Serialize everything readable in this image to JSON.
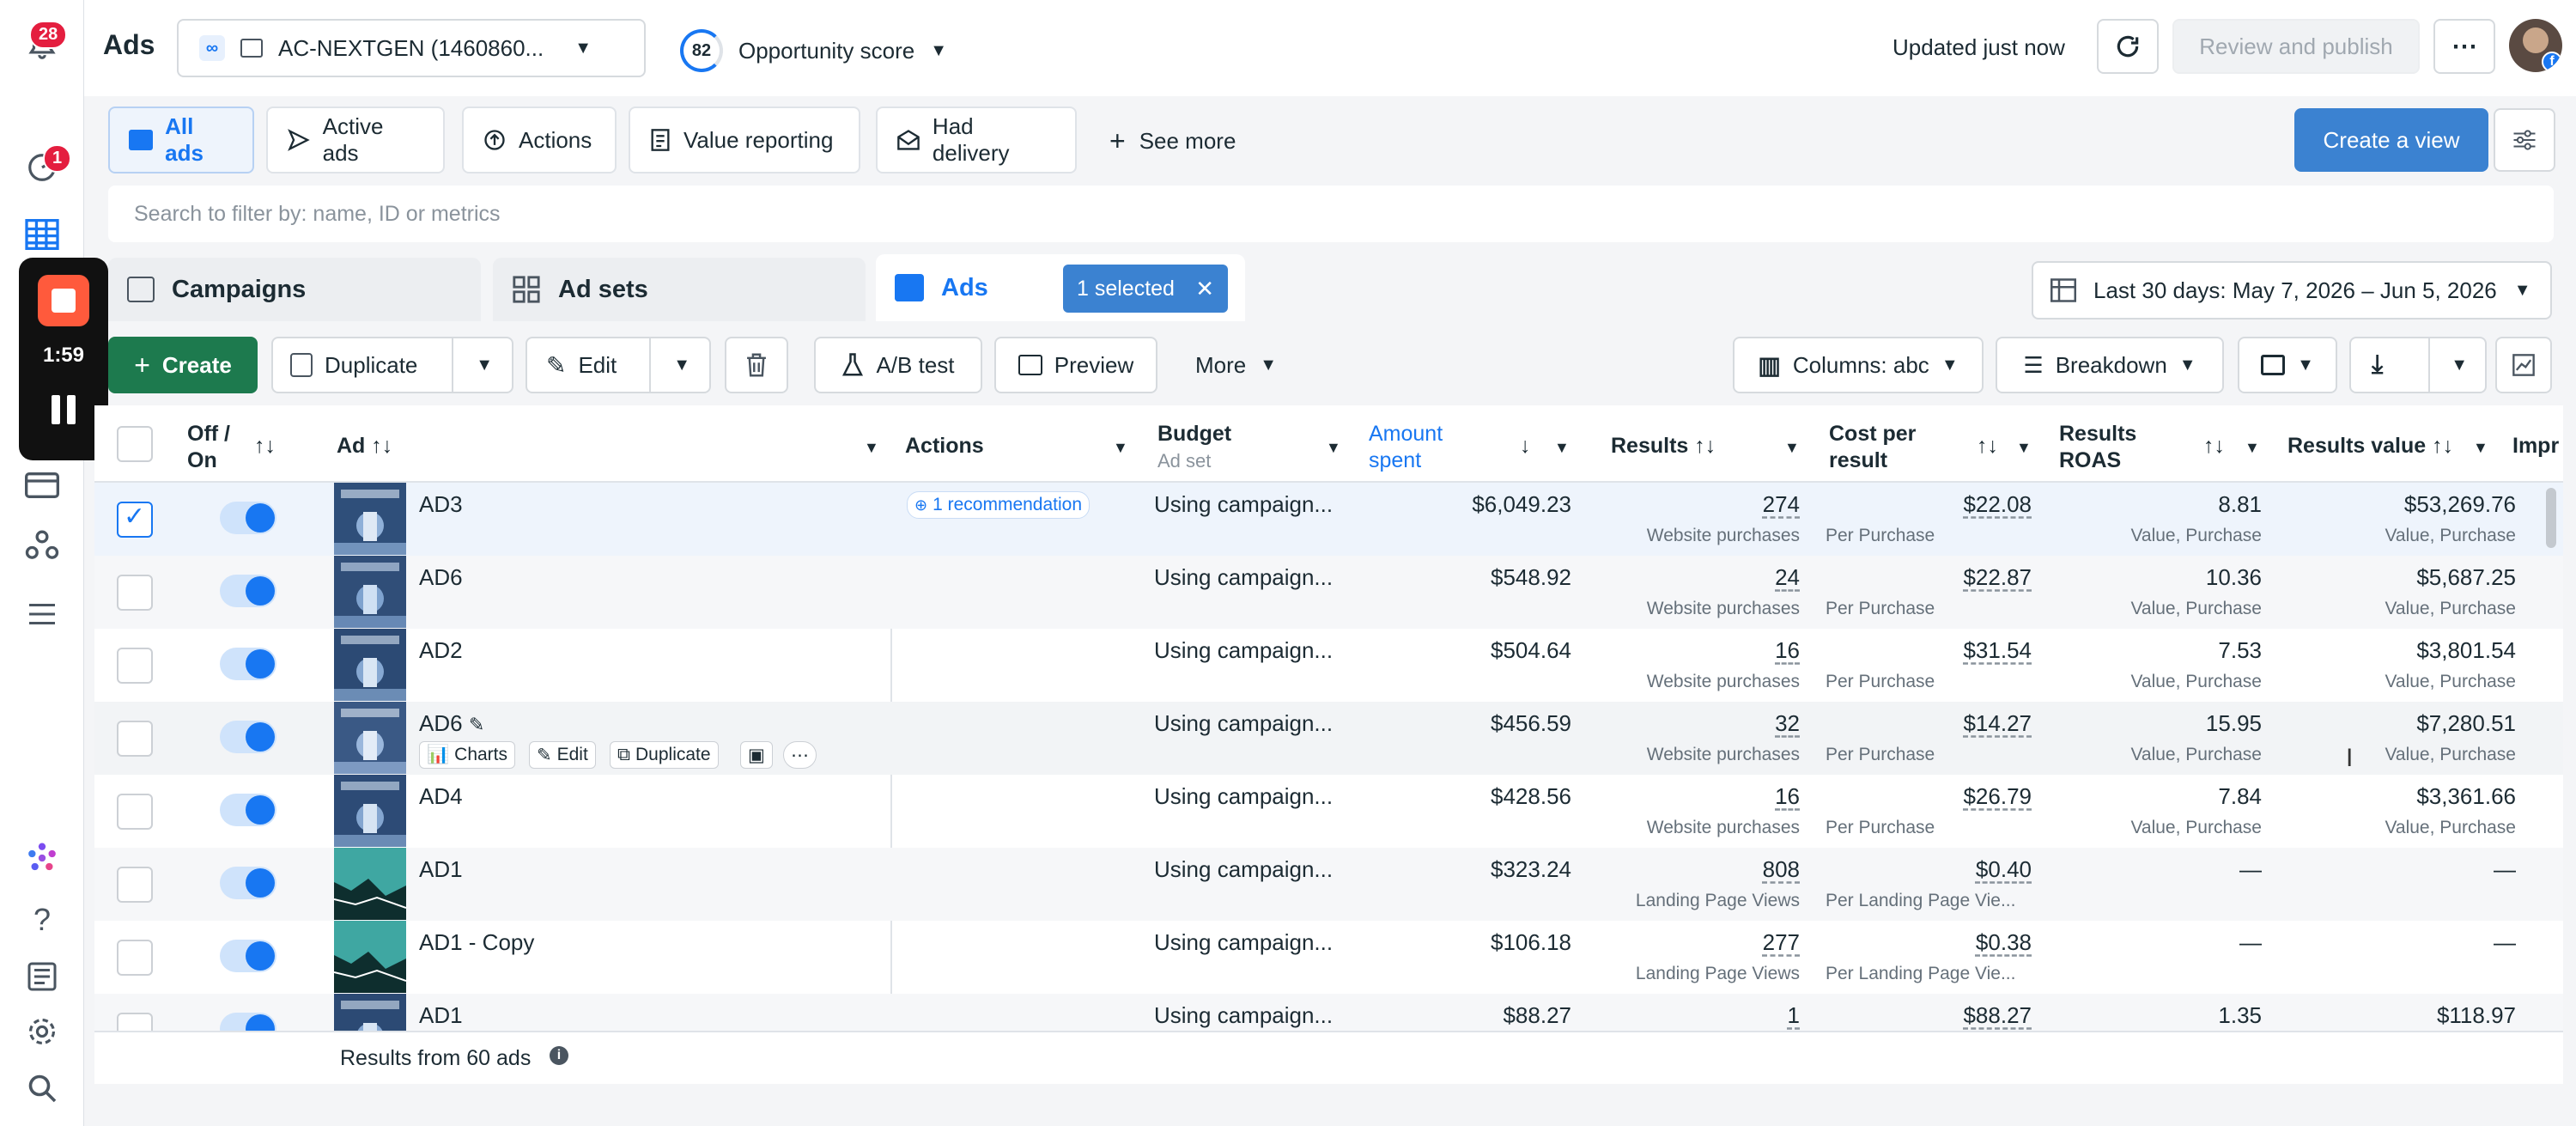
{
  "rail": {
    "notif_count": "28",
    "planner_count": "1",
    "recording_time": "1:59"
  },
  "header": {
    "title": "Ads",
    "account": "AC-NEXTGEN (1460860...",
    "opp_score": "82",
    "opp_label": "Opportunity score",
    "updated": "Updated just now",
    "review": "Review and publish"
  },
  "views": {
    "items": [
      "All ads",
      "Active ads",
      "Actions",
      "Value reporting",
      "Had delivery"
    ],
    "see_more": "See more",
    "create_view": "Create a view"
  },
  "search": {
    "placeholder": "Search to filter by: name, ID or metrics"
  },
  "levels": {
    "campaigns": "Campaigns",
    "adsets": "Ad sets",
    "ads": "Ads",
    "selected": "1 selected",
    "date": "Last 30 days: May 7, 2026 – Jun 5, 2026"
  },
  "toolbar": {
    "create": "Create",
    "duplicate": "Duplicate",
    "edit": "Edit",
    "abtest": "A/B test",
    "preview": "Preview",
    "more": "More",
    "columns": "Columns: abc",
    "breakdown": "Breakdown"
  },
  "table": {
    "headers": {
      "offon1": "Off /",
      "offon2": "On",
      "ad": "Ad",
      "actions": "Actions",
      "budget": "Budget",
      "budget_sub": "Ad set",
      "amount1": "Amount",
      "amount2": "spent",
      "results": "Results",
      "cpr1": "Cost per",
      "cpr2": "result",
      "roas1": "Results",
      "roas2": "ROAS",
      "value": "Results value",
      "impr": "Impr"
    },
    "row_actions": {
      "charts": "Charts",
      "edit": "Edit",
      "duplicate": "Duplicate"
    },
    "recommendation": "1 recommendation",
    "rows": [
      {
        "name": "AD3",
        "budget": "Using campaign...",
        "spent": "$6,049.23",
        "results": "274",
        "results_sub": "Website purchases",
        "cpr": "$22.08",
        "cpr_sub": "Per Purchase",
        "roas": "8.81",
        "roas_sub": "Value, Purchase",
        "value": "$53,269.76",
        "value_sub": "Value, Purchase"
      },
      {
        "name": "AD6",
        "budget": "Using campaign...",
        "spent": "$548.92",
        "results": "24",
        "results_sub": "Website purchases",
        "cpr": "$22.87",
        "cpr_sub": "Per Purchase",
        "roas": "10.36",
        "roas_sub": "Value, Purchase",
        "value": "$5,687.25",
        "value_sub": "Value, Purchase"
      },
      {
        "name": "AD2",
        "budget": "Using campaign...",
        "spent": "$504.64",
        "results": "16",
        "results_sub": "Website purchases",
        "cpr": "$31.54",
        "cpr_sub": "Per Purchase",
        "roas": "7.53",
        "roas_sub": "Value, Purchase",
        "value": "$3,801.54",
        "value_sub": "Value, Purchase"
      },
      {
        "name": "AD6",
        "budget": "Using campaign...",
        "spent": "$456.59",
        "results": "32",
        "results_sub": "Website purchases",
        "cpr": "$14.27",
        "cpr_sub": "Per Purchase",
        "roas": "15.95",
        "roas_sub": "Value, Purchase",
        "value": "$7,280.51",
        "value_sub": "Value, Purchase"
      },
      {
        "name": "AD4",
        "budget": "Using campaign...",
        "spent": "$428.56",
        "results": "16",
        "results_sub": "Website purchases",
        "cpr": "$26.79",
        "cpr_sub": "Per Purchase",
        "roas": "7.84",
        "roas_sub": "Value, Purchase",
        "value": "$3,361.66",
        "value_sub": "Value, Purchase"
      },
      {
        "name": "AD1",
        "budget": "Using campaign...",
        "spent": "$323.24",
        "results": "808",
        "results_sub": "Landing Page Views",
        "cpr": "$0.40",
        "cpr_sub": "Per Landing Page Vie...",
        "roas": "—",
        "roas_sub": "",
        "value": "—",
        "value_sub": ""
      },
      {
        "name": "AD1 - Copy",
        "budget": "Using campaign...",
        "spent": "$106.18",
        "results": "277",
        "results_sub": "Landing Page Views",
        "cpr": "$0.38",
        "cpr_sub": "Per Landing Page Vie...",
        "roas": "—",
        "roas_sub": "",
        "value": "—",
        "value_sub": ""
      },
      {
        "name": "AD1",
        "budget": "Using campaign...",
        "spent": "$88.27",
        "results": "1",
        "results_sub": "",
        "cpr": "$88.27",
        "cpr_sub": "",
        "roas": "1.35",
        "roas_sub": "",
        "value": "$118.97",
        "value_sub": ""
      }
    ],
    "footer": "Results from 60 ads"
  },
  "colors": {
    "accent": "#1877f2",
    "selected_bg": "#eef4fc",
    "hover_bg": "#f2f4f6"
  }
}
